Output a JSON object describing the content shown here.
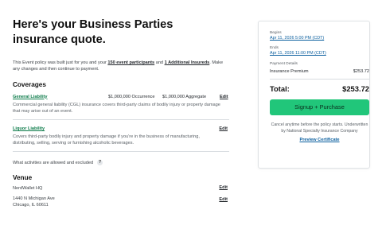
{
  "page": {
    "title": "Here's your Business Parties insurance quote.",
    "intro_prefix": "This Event policy was built just for you and your ",
    "intro_link1": "150 event participants",
    "intro_and": " and ",
    "intro_link2": "1 Additional Insureds",
    "intro_suffix": ". Make any changes and then continue to payment."
  },
  "coverages": {
    "heading": "Coverages",
    "items": [
      {
        "name": "General Liability",
        "occurrence": "$1,000,000 Occurrence",
        "aggregate": "$1,000,000 Aggregate",
        "edit": "Edit",
        "description": "Commercial general liability (CGL) insurance covers third-party claims of bodily injury or property damage that may arise out of an event."
      },
      {
        "name": "Liquor Liability",
        "edit": "Edit",
        "description": "Covers third-party bodily injury and property damage if you're in the business of manufacturing, distributing, selling, serving or furnishing alcoholic beverages."
      }
    ],
    "faq_text": "What activities are allowed and excluded",
    "faq_icon": "?"
  },
  "venue": {
    "heading": "Venue",
    "name": "NerdWallet HQ",
    "edit1": "Edit",
    "address1": "1440 N Michigan Ave",
    "address2": "Chicago, IL 60611",
    "edit2": "Edit"
  },
  "summary": {
    "begins_label": "Begins",
    "begins_value": "Apr 11, 2026 5:00 PM (CDT)",
    "ends_label": "Ends",
    "ends_value": "Apr 11, 2026 11:00 PM (CDT)",
    "payment_details_label": "Payment Details",
    "premium_label": "Insurance Premium",
    "premium_value": "$253.72",
    "total_label": "Total:",
    "total_value": "$253.72",
    "cta_label": "Signup + Purchase",
    "cancel_note": "Cancel anytime before the policy starts. Underwritten by National Specialty Insurance Company",
    "preview_label": "Preview Certificate"
  },
  "colors": {
    "accent_green": "#21c67a",
    "link_blue": "#0a5e9e",
    "coverage_link_green": "#0a7a48"
  }
}
